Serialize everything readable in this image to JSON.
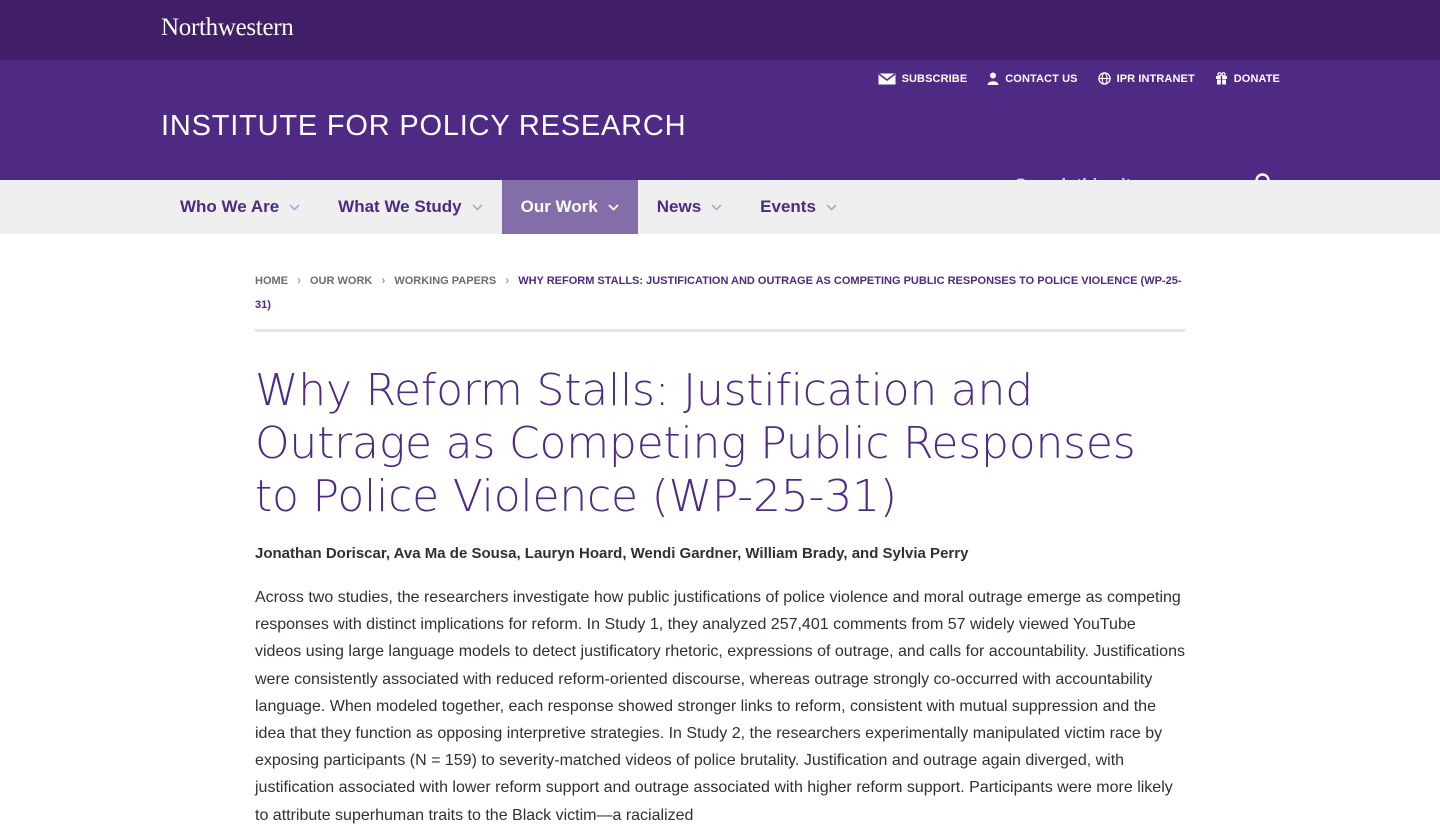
{
  "university": {
    "name": "Northwestern"
  },
  "utility_nav": [
    {
      "label": "SUBSCRIBE",
      "icon": "envelope-icon"
    },
    {
      "label": "CONTACT US",
      "icon": "person-icon"
    },
    {
      "label": "IPR INTRANET",
      "icon": "globe-icon"
    },
    {
      "label": "DONATE",
      "icon": "gift-icon"
    }
  ],
  "site": {
    "title": "INSTITUTE FOR POLICY RESEARCH"
  },
  "search": {
    "placeholder": "Search this site"
  },
  "main_nav": [
    {
      "label": "Who We Are",
      "active": false
    },
    {
      "label": "What We Study",
      "active": false
    },
    {
      "label": "Our Work",
      "active": true
    },
    {
      "label": "News",
      "active": false
    },
    {
      "label": "Events",
      "active": false
    }
  ],
  "breadcrumb": {
    "items": [
      "HOME",
      "OUR WORK",
      "WORKING PAPERS"
    ],
    "current": "WHY REFORM STALLS: JUSTIFICATION AND OUTRAGE AS COMPETING PUBLIC RESPONSES TO POLICE VIOLENCE (WP-25-31)"
  },
  "paper": {
    "title": "Why Reform Stalls: Justification and Outrage as Competing Public Responses to Police Violence (WP-25-31)",
    "authors": "Jonathan Doriscar, Ava Ma de Sousa, Lauryn Hoard, Wendi Gardner, William Brady, and Sylvia Perry",
    "abstract": "Across two studies, the researchers investigate how public justifications of police violence and moral outrage emerge as competing responses with distinct implications for reform. In Study 1, they analyzed 257,401 comments from 57 widely viewed YouTube videos using large language models to detect justificatory rhetoric, expressions of outrage, and calls for accountability. Justifications were consistently associated with reduced reform-oriented discourse, whereas outrage strongly co-occurred with accountability language. When modeled together, each response showed stronger links to reform, consistent with mutual suppression and the idea that they function as opposing interpretive strategies. In Study 2, the researchers experimentally manipulated victim race by exposing participants (N = 159) to severity-matched videos of police brutality. Justification and outrage again diverged, with justification associated with lower reform support and outrage associated with higher reform support. Participants were more likely to attribute superhuman traits to the Black victim—a racialized"
  },
  "colors": {
    "nu_purple_dark": "#401f68",
    "nu_purple": "#4e2a84",
    "nav_active": "#836eaa",
    "nav_bg": "#efefef"
  }
}
